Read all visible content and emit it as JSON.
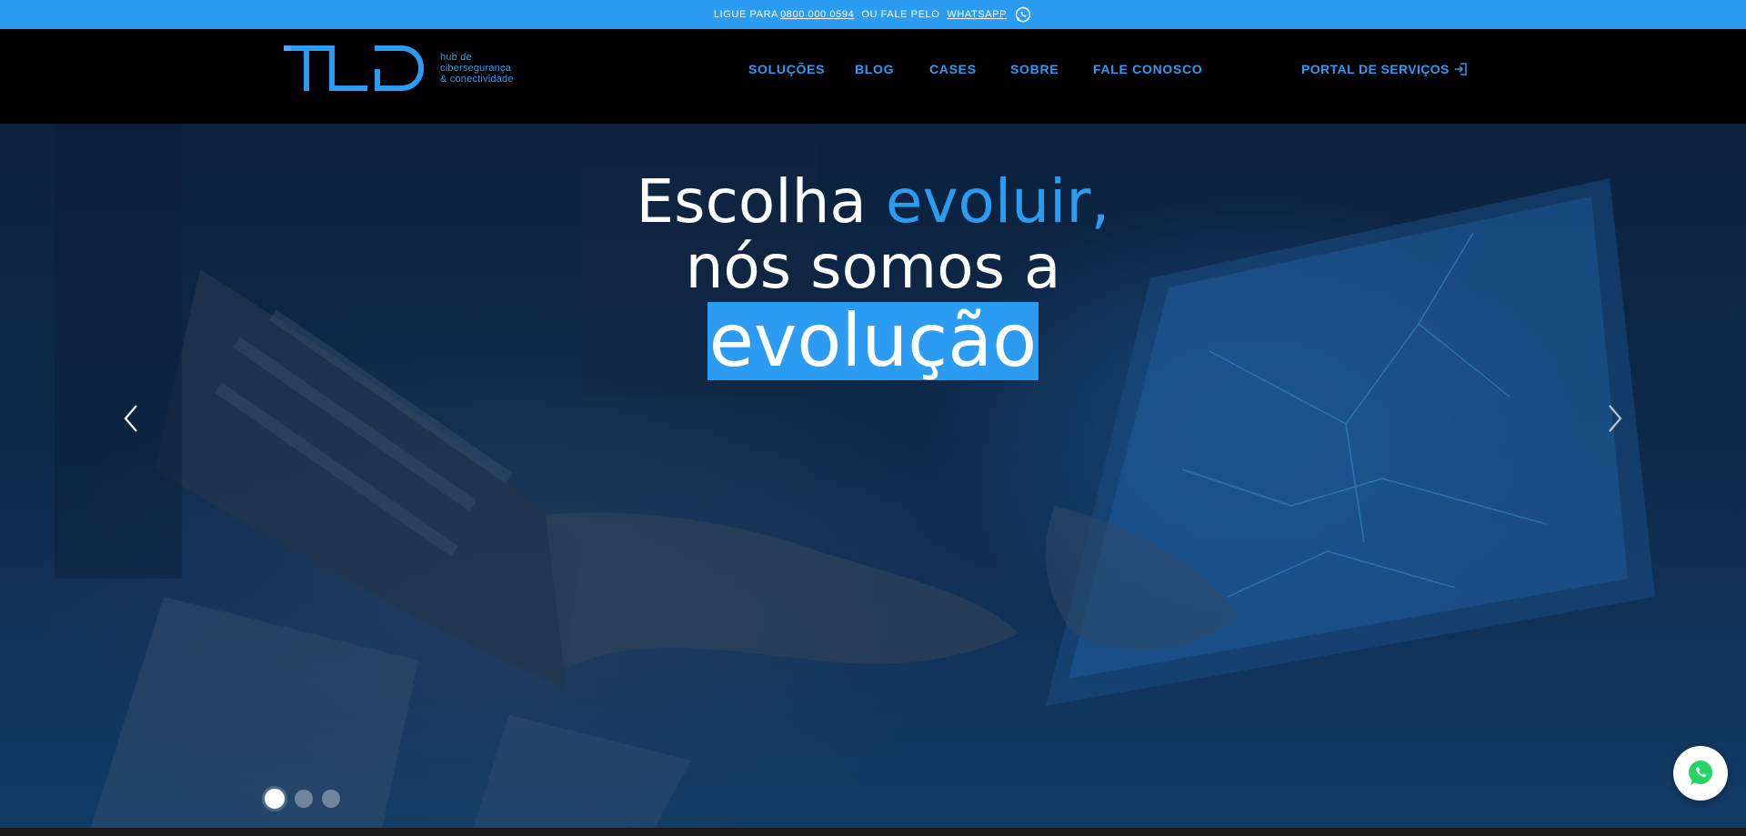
{
  "topbar": {
    "prefix": "LIGUE PARA",
    "phone": "0800 000 0594",
    "middle": "OU  FALE PELO",
    "whatsapp_label": "WHATSAPP",
    "icon": "whatsapp-icon"
  },
  "header": {
    "logo_text": "TLD",
    "logo_tagline": [
      "hub de",
      "cibersegurança",
      "& conectividade"
    ],
    "nav": [
      {
        "label": "SOLUÇÕES"
      },
      {
        "label": "BLOG"
      },
      {
        "label": "CASES"
      },
      {
        "label": "SOBRE"
      },
      {
        "label": "FALE CONOSCO"
      }
    ],
    "portal_label": "PORTAL DE SERVIÇOS",
    "portal_icon": "login-icon"
  },
  "hero": {
    "line1_white": "Escolha ",
    "line1_blue": "evoluir,",
    "line2": "nós somos a",
    "line3": "evolução",
    "prev_icon": "chevron-left-icon",
    "next_icon": "chevron-right-icon",
    "slides_count": 3,
    "active_slide": 1
  },
  "floating": {
    "icon": "whatsapp-icon"
  },
  "colors": {
    "accent": "#2b9cf2",
    "header_bg": "#000000",
    "topbar_bg": "#2b9cf2",
    "text_light": "#ffffff",
    "whatsapp_green": "#25d366"
  }
}
